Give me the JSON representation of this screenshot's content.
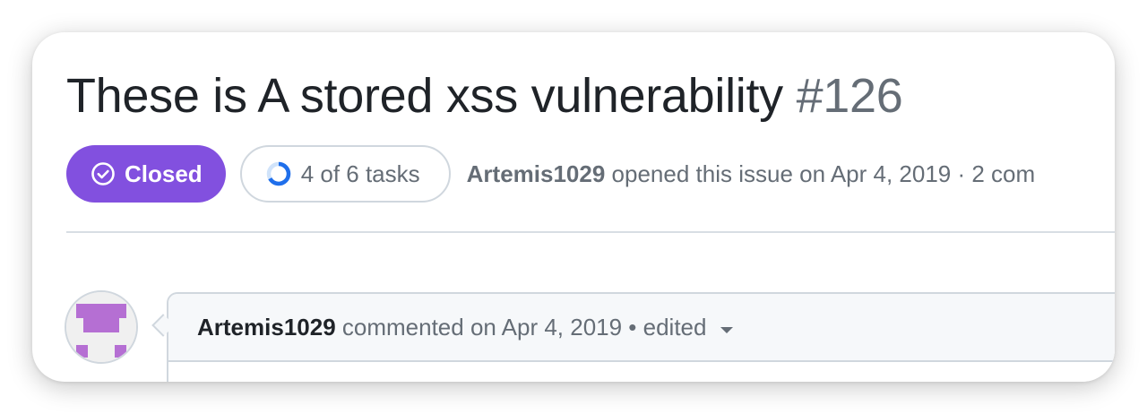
{
  "issue": {
    "title": "These is A stored xss vulnerability",
    "number": "#126",
    "state": {
      "label": "Closed",
      "icon": "issue-closed-icon",
      "color": "#8250df"
    },
    "tasks": {
      "label": "4 of 6 tasks",
      "icon": "progress-ring-icon",
      "completed": 4,
      "total": 6
    },
    "opened_by": "Artemis1029",
    "opened_text": " opened this issue on Apr 4, 2019 · 2 com"
  },
  "comment": {
    "author": "Artemis1029",
    "meta": " commented on Apr 4, 2019 • ",
    "edited_label": "edited",
    "avatar_icon": "identicon-avatar",
    "avatar_color": "#b56fd3"
  }
}
